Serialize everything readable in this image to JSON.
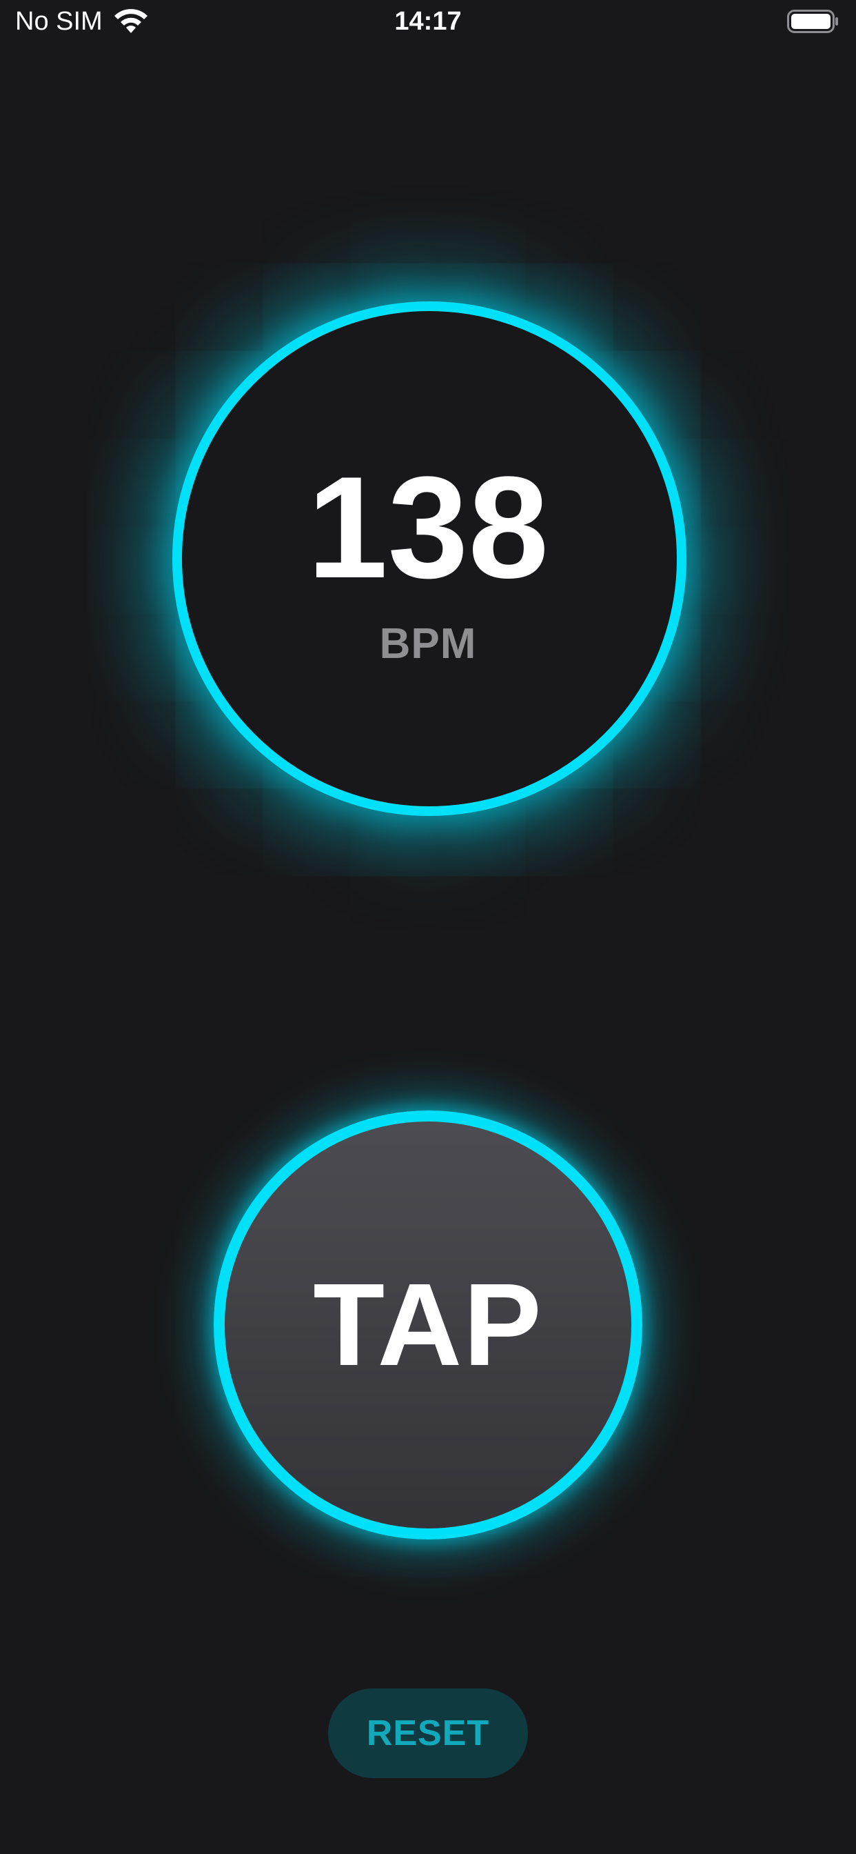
{
  "status_bar": {
    "carrier": "No SIM",
    "time": "14:17",
    "wifi_icon": "wifi-icon",
    "battery_icon": "battery-icon"
  },
  "bpm_display": {
    "value": "138",
    "unit": "BPM"
  },
  "tap_button": {
    "label": "TAP"
  },
  "reset_button": {
    "label": "RESET"
  },
  "colors": {
    "background": "#18181a",
    "accent_cyan": "#00e0f8",
    "reset_bg": "#0f3a40",
    "reset_text": "#12a9bd",
    "unit_text": "#8e8e93"
  }
}
